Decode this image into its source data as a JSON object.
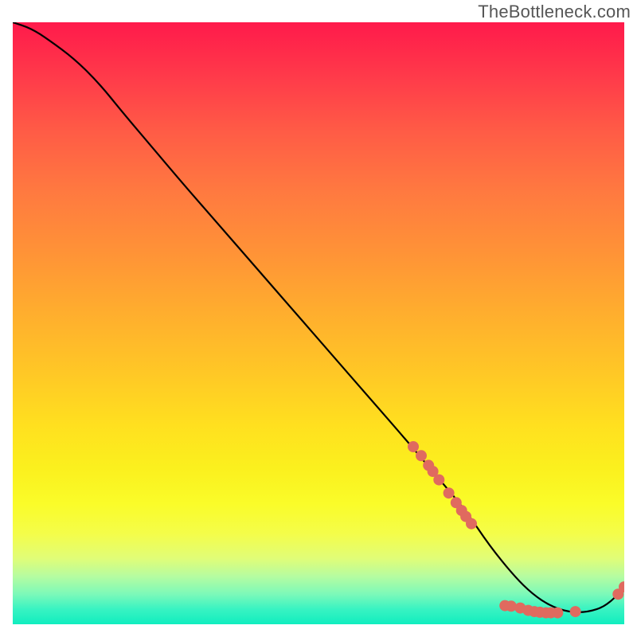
{
  "attribution": "TheBottleneck.com",
  "chart_data": {
    "type": "line",
    "title": "",
    "xlabel": "",
    "ylabel": "",
    "xlim": [
      0,
      100
    ],
    "ylim": [
      0,
      100
    ],
    "grid": false,
    "legend": false,
    "series": [
      {
        "name": "curve",
        "x": [
          0,
          3,
          6,
          10,
          14,
          18,
          23,
          28,
          34,
          40,
          46,
          52,
          58,
          64,
          69,
          74,
          78,
          82,
          85,
          88,
          91,
          94,
          97,
          100
        ],
        "y": [
          100,
          99,
          97,
          94,
          90,
          85,
          79,
          73,
          66,
          59,
          52,
          45,
          38,
          31,
          25,
          19,
          13,
          8,
          5,
          3,
          2,
          2,
          3,
          6
        ]
      }
    ],
    "markers": [
      {
        "name": "highlight-cluster",
        "color": "#e06a5f",
        "radius": 7,
        "points": [
          {
            "x": 65.5,
            "y": 29.5
          },
          {
            "x": 66.8,
            "y": 28.0
          },
          {
            "x": 68.0,
            "y": 26.4
          },
          {
            "x": 68.7,
            "y": 25.4
          },
          {
            "x": 69.7,
            "y": 24.0
          },
          {
            "x": 71.3,
            "y": 21.8
          },
          {
            "x": 72.5,
            "y": 20.2
          },
          {
            "x": 73.4,
            "y": 18.9
          },
          {
            "x": 74.1,
            "y": 17.9
          },
          {
            "x": 75.0,
            "y": 16.7
          },
          {
            "x": 80.5,
            "y": 3.1
          },
          {
            "x": 81.5,
            "y": 3.0
          },
          {
            "x": 83.0,
            "y": 2.7
          },
          {
            "x": 84.3,
            "y": 2.3
          },
          {
            "x": 85.3,
            "y": 2.1
          },
          {
            "x": 86.2,
            "y": 2.0
          },
          {
            "x": 87.2,
            "y": 1.9
          },
          {
            "x": 88.0,
            "y": 1.9
          },
          {
            "x": 89.1,
            "y": 1.9
          },
          {
            "x": 92.0,
            "y": 2.1
          },
          {
            "x": 99.0,
            "y": 5.0
          },
          {
            "x": 100.0,
            "y": 6.2
          }
        ]
      }
    ]
  },
  "colors": {
    "line": "#000000",
    "marker": "#e06a5f",
    "attribution": "#565656"
  }
}
